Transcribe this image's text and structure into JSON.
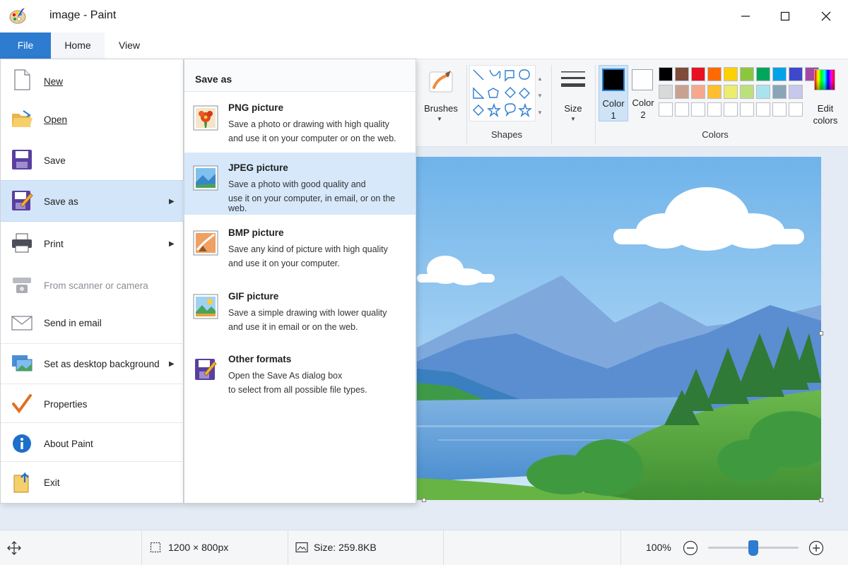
{
  "window": {
    "title": "image - Paint"
  },
  "tabs": [
    {
      "label": "File"
    },
    {
      "label": "Home"
    },
    {
      "label": "View"
    }
  ],
  "ribbon": {
    "brushes_label": "Brushes",
    "shapes_label": "Shapes",
    "size_label": "Size",
    "color1_label": [
      "Color",
      "1"
    ],
    "color2_label": [
      "Color",
      "2"
    ],
    "edit_colors_label": [
      "Edit",
      "colors"
    ],
    "colors_label": "Colors",
    "color1": "#000000",
    "color2": "#ffffff",
    "palette_row1": [
      "#000000",
      "#7f4b3a",
      "#e81123",
      "#ff6a00",
      "#ffd000",
      "#8cc63f",
      "#00a65a",
      "#00a2e8",
      "#3f48cc",
      "#a349a4"
    ],
    "palette_row2": [
      "#d9d9d9",
      "#c8a290",
      "#f7a78c",
      "#ffbe2e",
      "#ecec6e",
      "#bde07a",
      "#a8e4f0",
      "#8aa4b8",
      "#c8c8ea"
    ]
  },
  "file_menu": {
    "items": [
      {
        "label": "New",
        "icon": "new-file-icon"
      },
      {
        "label": "Open",
        "icon": "open-folder-icon"
      },
      {
        "label": "Save",
        "icon": "save-disk-icon"
      },
      {
        "label": "Save as",
        "icon": "save-as-icon"
      },
      {
        "label": "Print",
        "icon": "printer-icon"
      },
      {
        "label": "From scanner or camera",
        "icon": "scanner-icon"
      },
      {
        "label": "Send in email",
        "icon": "email-icon"
      },
      {
        "label": "Set as desktop background",
        "icon": "desktop-background-icon"
      },
      {
        "label": "Properties",
        "icon": "checkmark-icon"
      },
      {
        "label": "About Paint",
        "icon": "info-icon"
      },
      {
        "label": "Exit",
        "icon": "exit-icon"
      }
    ]
  },
  "save_as_menu": {
    "header": "Save as",
    "items": [
      {
        "title": "PNG picture",
        "line1": "Save a photo or drawing with high quality",
        "line2": "and use it on your computer or on the web."
      },
      {
        "title": "JPEG picture",
        "line1": "Save a photo with good quality and",
        "line2": "use it on your computer, in email, or on the web."
      },
      {
        "title": "BMP picture",
        "line1": "Save any kind of picture with high quality",
        "line2": "and use it on your computer."
      },
      {
        "title": "GIF picture",
        "line1": "Save a simple drawing with lower quality",
        "line2": "and use it in email or on the web."
      },
      {
        "title": "Other formats",
        "line1": "Open the Save As dialog box",
        "line2": "to select from all possible file types."
      }
    ]
  },
  "status_bar": {
    "dimensions": "1200 × 800px",
    "size": "Size: 259.8KB",
    "zoom": "100%",
    "zoom_level": 0.5
  }
}
